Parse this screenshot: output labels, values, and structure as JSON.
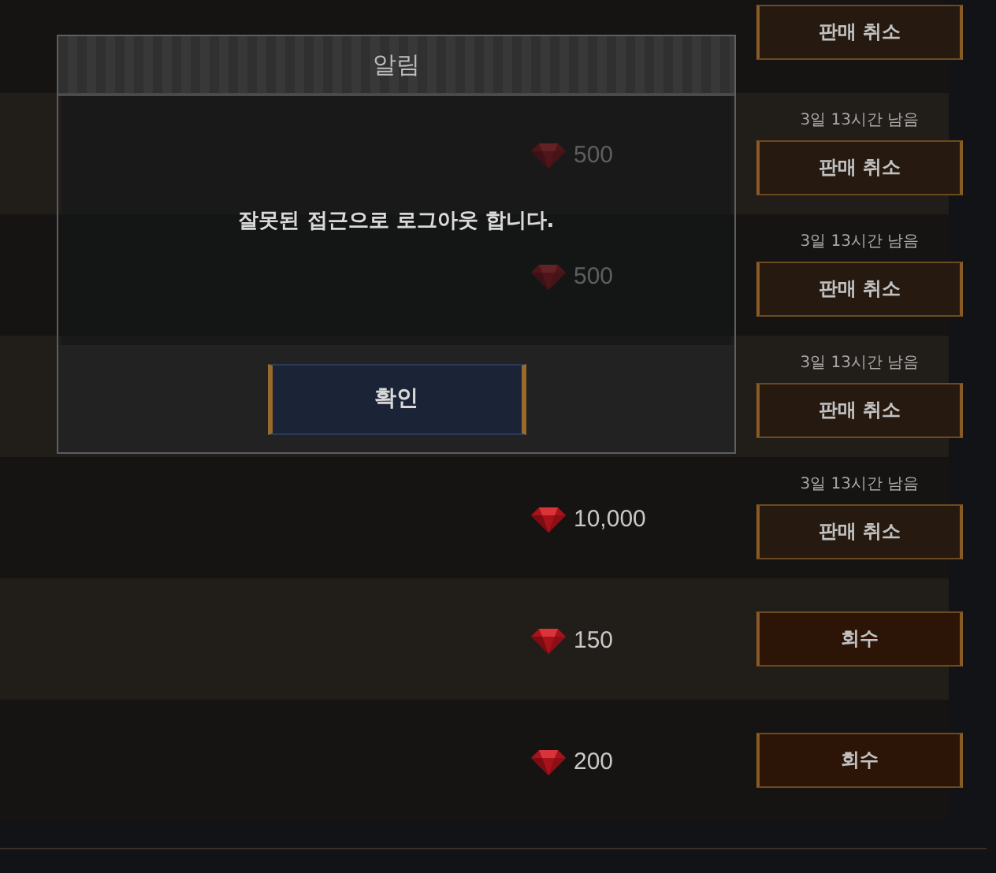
{
  "listings": [
    {
      "action": "판매 취소",
      "kind": "cancel"
    },
    {
      "price": "500",
      "remaining": "3일 13시간 남음",
      "action": "판매 취소",
      "kind": "cancel"
    },
    {
      "price": "500",
      "remaining": "3일 13시간 남음",
      "action": "판매 취소",
      "kind": "cancel"
    },
    {
      "remaining": "3일 13시간 남음",
      "action": "판매 취소",
      "kind": "cancel"
    },
    {
      "price": "10,000",
      "remaining": "3일 13시간 남음",
      "action": "판매 취소",
      "kind": "cancel"
    },
    {
      "price": "150",
      "action": "회수",
      "kind": "reclaim"
    },
    {
      "price": "200",
      "action": "회수",
      "kind": "reclaim"
    }
  ],
  "dialog": {
    "title": "알림",
    "message": "잘못된 접근으로 로그아웃 합니다.",
    "button": "확인"
  }
}
